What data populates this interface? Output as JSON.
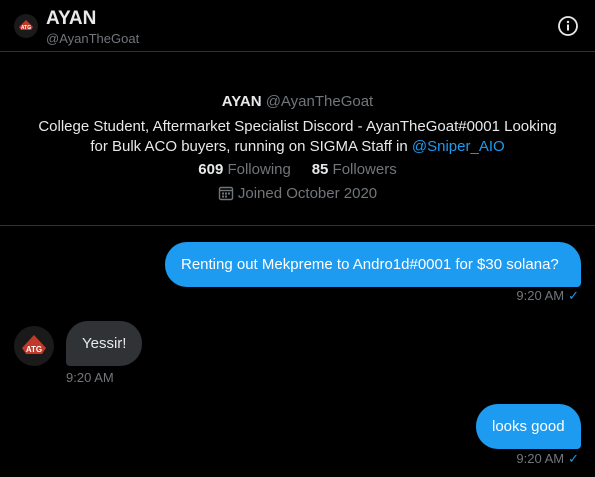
{
  "header": {
    "name": "AYAN",
    "handle": "@AyanTheGoat"
  },
  "profile": {
    "name": "AYAN",
    "handle": "@AyanTheGoat",
    "bio_line1": "College Student, Aftermarket Specialist Discord - AyanTheGoat#0001 Looking",
    "bio_line2_prefix": "for Bulk ACO buyers, running on SIGMA Staff in ",
    "bio_mention": "@Sniper_AIO",
    "following_count": "609",
    "following_label": "Following",
    "followers_count": "85",
    "followers_label": "Followers",
    "joined": "Joined October 2020"
  },
  "messages": [
    {
      "direction": "out",
      "text": "Renting out Mekpreme to Andro1d#0001 for $30 solana?",
      "time": "9:20 AM",
      "status": "✓"
    },
    {
      "direction": "in",
      "text": "Yessir!",
      "time": "9:20 AM"
    },
    {
      "direction": "out",
      "text": "looks good",
      "time": "9:20 AM",
      "status": "✓"
    }
  ],
  "avatar_badge": "ATG",
  "colors": {
    "accent": "#1d9bf0",
    "background": "#000000",
    "incoming_bubble": "#2f3336",
    "muted_text": "#71767b"
  }
}
